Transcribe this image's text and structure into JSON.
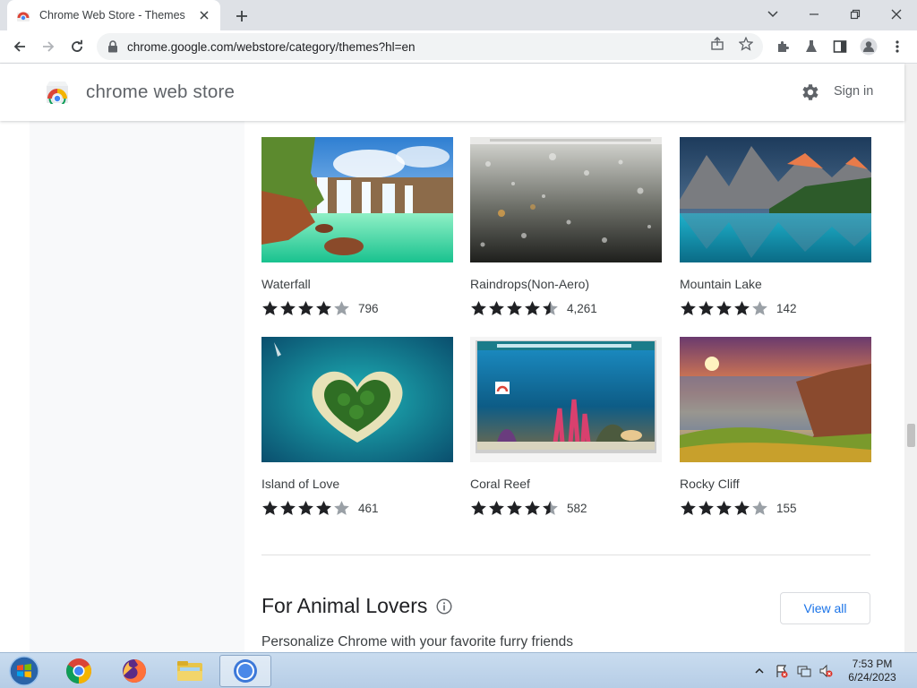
{
  "browser": {
    "tab_title": "Chrome Web Store - Themes",
    "url": "chrome.google.com/webstore/category/themes?hl=en"
  },
  "store": {
    "name": "chrome web store",
    "signin_label": "Sign in"
  },
  "themes": [
    {
      "title": "Waterfall",
      "stars": 4,
      "rating_count": "796"
    },
    {
      "title": "Raindrops(Non-Aero)",
      "stars": 4.5,
      "rating_count": "4,261"
    },
    {
      "title": "Mountain Lake",
      "stars": 4,
      "rating_count": "142"
    },
    {
      "title": "Island of Love",
      "stars": 4,
      "rating_count": "461"
    },
    {
      "title": "Coral Reef",
      "stars": 4.5,
      "rating_count": "582"
    },
    {
      "title": "Rocky Cliff",
      "stars": 4,
      "rating_count": "155"
    }
  ],
  "section": {
    "title": "For Animal Lovers",
    "subtitle": "Personalize Chrome with your favorite furry friends",
    "view_all_label": "View all"
  },
  "taskbar": {
    "time": "7:53 PM",
    "date": "6/24/2023"
  },
  "colors": {
    "link_blue": "#1a73e8",
    "star_dark": "#202124",
    "star_empty": "#9aa0a6"
  }
}
